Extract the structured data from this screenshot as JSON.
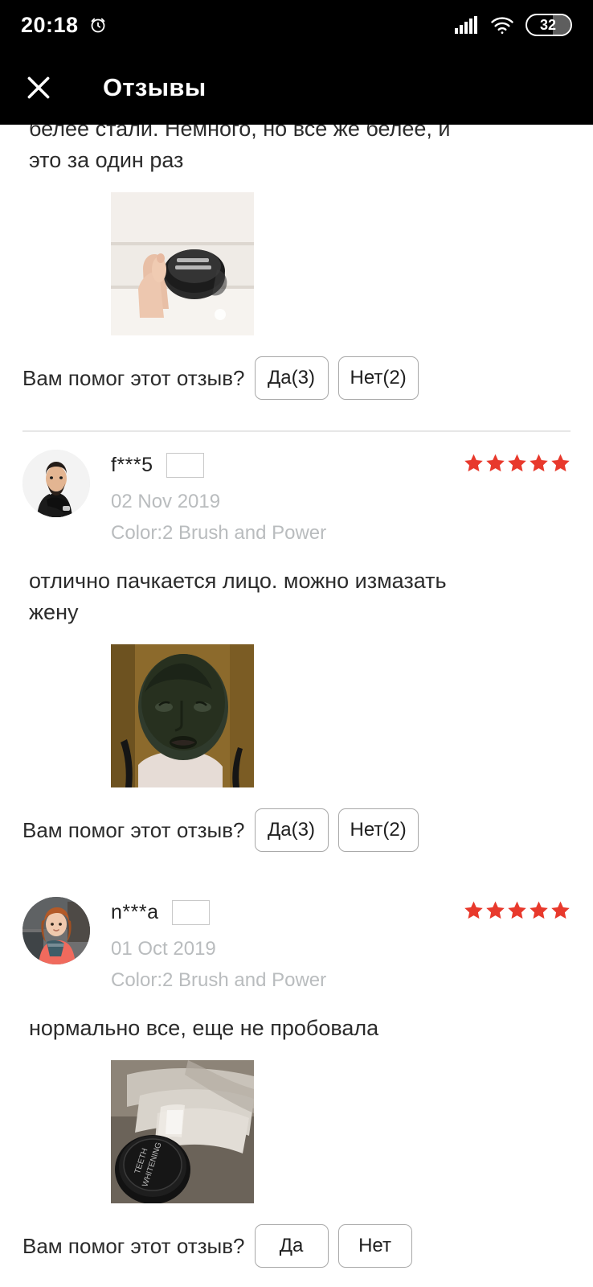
{
  "status_bar": {
    "time": "20:18",
    "alarm_icon": "alarm-clock-icon",
    "signal_icon": "cellular-signal-icon",
    "wifi_icon": "wifi-icon",
    "battery_level": "32"
  },
  "app_bar": {
    "close_icon": "close-icon",
    "title": "Отзывы"
  },
  "helpful_question": "Вам помог этот отзыв?",
  "reviews": [
    {
      "clipped": true,
      "text": "белее стали. Немного, но всё же белее, и это за один раз",
      "photo_alt": "hand-holding-black-teeth-whitening-jar",
      "yes_label": "Да(3)",
      "no_label": "Нет(2)"
    },
    {
      "clipped": false,
      "user_name": "f***5",
      "country_flag": "russia-flag",
      "date": "02 Nov 2019",
      "color_option": "Color:2 Brush and Power",
      "rating": 5,
      "text": "отлично пачкается лицо. можно измазать жену",
      "photo_alt": "face-covered-in-black-powder",
      "yes_label": "Да(3)",
      "no_label": "Нет(2)"
    },
    {
      "clipped": false,
      "user_name": "n***a",
      "country_flag": "russia-flag",
      "date": "01 Oct 2019",
      "color_option": "Color:2 Brush and Power",
      "rating": 5,
      "text": "нормально все, еще не пробовала",
      "photo_alt": "black-teeth-whitening-jar-with-bubble-wrap",
      "yes_label": "Да",
      "no_label": "Нет"
    }
  ],
  "colors": {
    "star": "#e8392c",
    "app_bar_bg": "#000000",
    "meta_text": "#b9bcbe",
    "button_border": "#a8a8a8"
  }
}
